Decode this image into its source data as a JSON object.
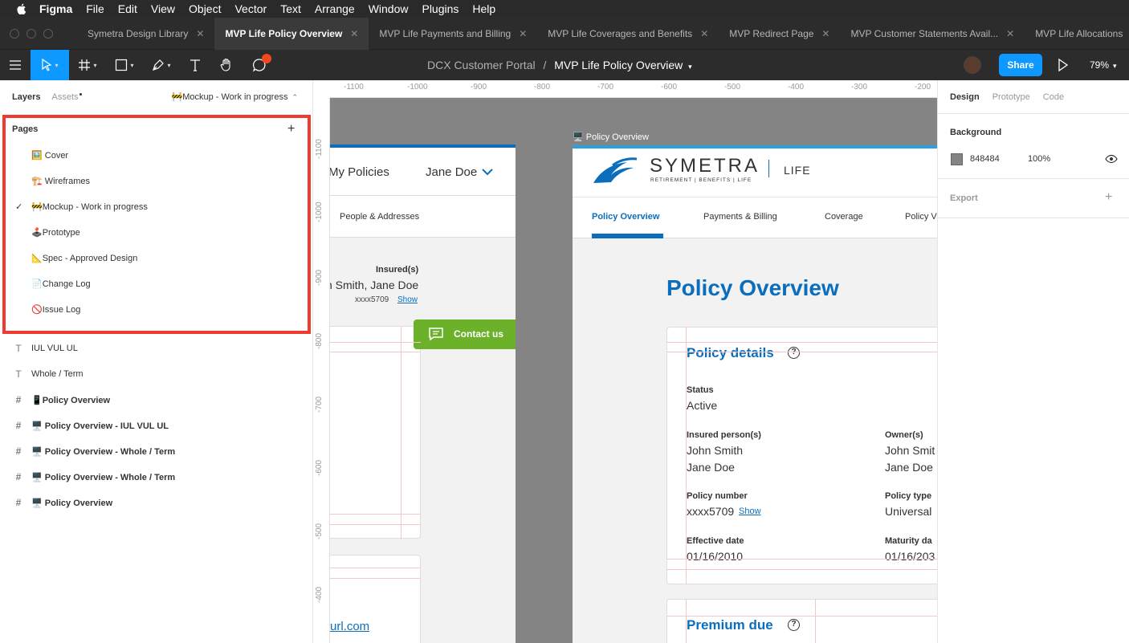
{
  "menubar": {
    "app": "Figma",
    "items": [
      "File",
      "Edit",
      "View",
      "Object",
      "Vector",
      "Text",
      "Arrange",
      "Window",
      "Plugins",
      "Help"
    ]
  },
  "tabs": [
    {
      "label": "Symetra Design Library",
      "active": false
    },
    {
      "label": "MVP Life Policy Overview",
      "active": true
    },
    {
      "label": "MVP Life Payments and Billing",
      "active": false
    },
    {
      "label": "MVP Life Coverages and Benefits",
      "active": false
    },
    {
      "label": "MVP Redirect Page",
      "active": false
    },
    {
      "label": "MVP Customer Statements Avail...",
      "active": false
    },
    {
      "label": "MVP Life Allocations",
      "active": false
    }
  ],
  "toolbar": {
    "project": "DCX Customer Portal",
    "separator": "/",
    "file": "MVP Life Policy Overview",
    "share_label": "Share",
    "zoom": "79%"
  },
  "left_panel": {
    "tab_layers": "Layers",
    "tab_assets": "Assets",
    "current_page": "🚧Mockup - Work in progress",
    "pages_heading": "Pages",
    "pages": [
      {
        "label": "🖼️ Cover",
        "selected": false
      },
      {
        "label": "🏗️ Wireframes",
        "selected": false
      },
      {
        "label": "🚧Mockup - Work in progress",
        "selected": true
      },
      {
        "label": "🕹️Prototype",
        "selected": false
      },
      {
        "label": "📐Spec - Approved Design",
        "selected": false
      },
      {
        "label": "📄Change Log",
        "selected": false
      },
      {
        "label": "🚫Issue Log",
        "selected": false
      }
    ],
    "layers": [
      {
        "type": "text",
        "label": "IUL VUL UL"
      },
      {
        "type": "text",
        "label": "Whole / Term"
      },
      {
        "type": "frame",
        "label": "📱Policy Overview"
      },
      {
        "type": "frame",
        "label": "🖥️ Policy Overview - IUL VUL UL"
      },
      {
        "type": "frame",
        "label": "🖥️ Policy Overview - Whole / Term"
      },
      {
        "type": "frame",
        "label": "🖥️ Policy Overview - Whole / Term"
      },
      {
        "type": "frame",
        "label": "🖥️ Policy Overview"
      }
    ]
  },
  "canvas": {
    "ruler_top": [
      "-1100",
      "-1000",
      "-900",
      "-800",
      "-700",
      "-600",
      "-500",
      "-400",
      "-300",
      "-200"
    ],
    "ruler_left": [
      "-1100",
      "-1000",
      "-900",
      "-800",
      "-700",
      "-600",
      "-500",
      "-400"
    ],
    "frame_label": "🖥️ Policy Overview",
    "left_frame": {
      "nav_my_policies": "My Policies",
      "user_name": "Jane Doe",
      "tab_people": "People & Addresses",
      "insured_label": "Insured(s)",
      "insured_value": "n Smith, Jane Doe",
      "policy_masked": "xxxx5709",
      "show_link": "Show",
      "contact_label": "Contact us",
      "link_fragment": "url.com"
    },
    "right_frame": {
      "brand": "SYMETRA",
      "brand_sub": "RETIREMENT | BENEFITS | LIFE",
      "product": "LIFE",
      "nav": [
        "Policy Overview",
        "Payments & Billing",
        "Coverage",
        "Policy V"
      ],
      "page_title": "Policy Overview",
      "card_title": "Policy details",
      "status_label": "Status",
      "status_value": "Active",
      "insured_label": "Insured person(s)",
      "insured_1": "John Smith",
      "insured_2": "Jane Doe",
      "owner_label": "Owner(s)",
      "owner_1": "John Smit",
      "owner_2": "Jane Doe",
      "policy_number_label": "Policy number",
      "policy_number_value": "xxxx5709",
      "show_link": "Show",
      "policy_type_label": "Policy type",
      "policy_type_value": "Universal",
      "effective_label": "Effective date",
      "effective_value": "01/16/2010",
      "maturity_label": "Maturity da",
      "maturity_value": "01/16/203",
      "premium_title": "Premium due"
    }
  },
  "right_panel": {
    "tabs": [
      "Design",
      "Prototype",
      "Code"
    ],
    "background_heading": "Background",
    "bg_hex": "848484",
    "bg_opacity": "100%",
    "export_heading": "Export"
  },
  "colors": {
    "accent": "#0d99ff",
    "symetra_blue": "#0a6ebd",
    "contact_green": "#6cb12a",
    "highlight_red": "#f03b30"
  }
}
